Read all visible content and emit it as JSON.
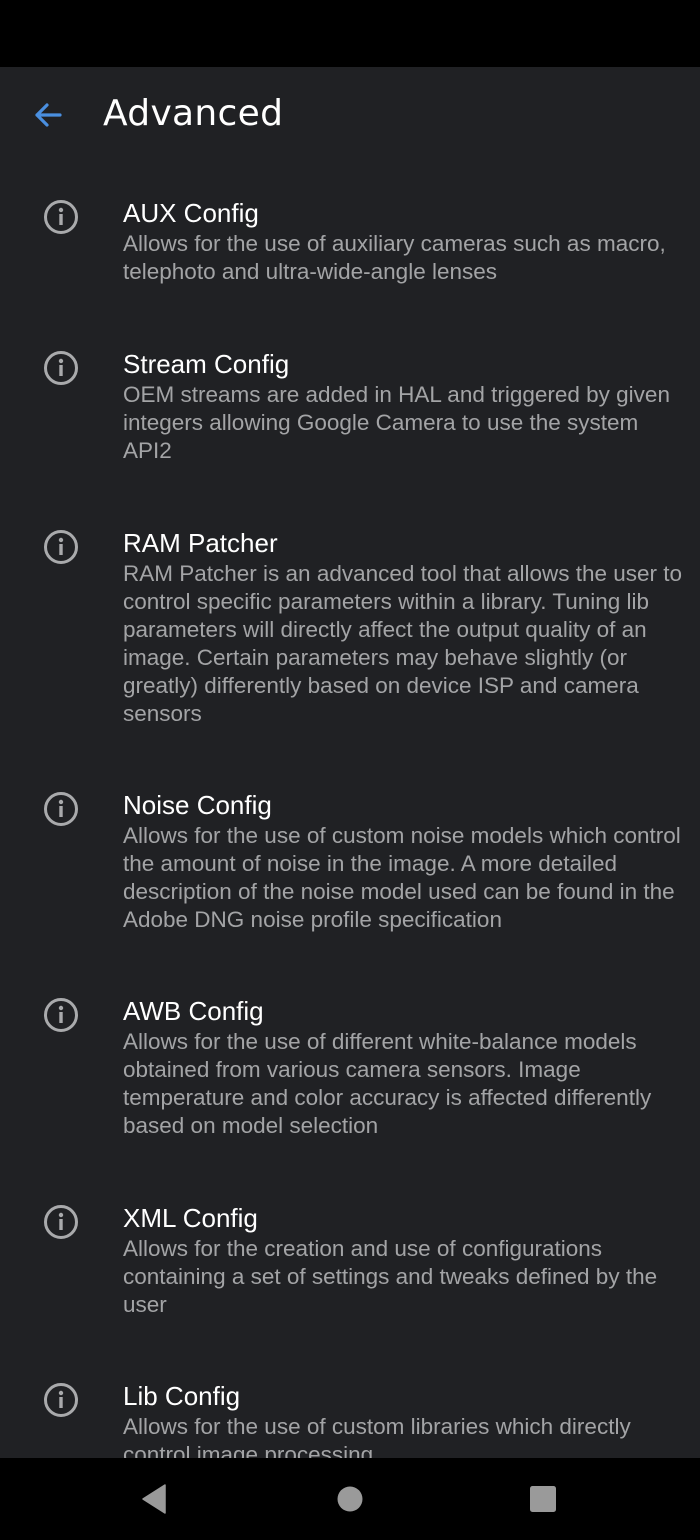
{
  "app_bar": {
    "title": "Advanced",
    "back_icon": "arrow-back-icon",
    "accent_color": "#4a8fe0"
  },
  "items": [
    {
      "icon": "info-icon",
      "title": "AUX Config",
      "description": "Allows for the use of auxiliary cameras such as macro, telephoto and ultra-wide-angle lenses"
    },
    {
      "icon": "info-icon",
      "title": "Stream Config",
      "description": "OEM streams are added in HAL and triggered by given integers allowing Google Camera to use the system API2"
    },
    {
      "icon": "info-icon",
      "title": "RAM Patcher",
      "description": "RAM Patcher is an advanced tool that allows the user to control specific parameters within a library. Tuning lib parameters will directly affect the output quality of an image. Certain parameters may behave slightly (or greatly) differently based on device ISP and camera sensors"
    },
    {
      "icon": "info-icon",
      "title": "Noise Config",
      "description": "Allows for the use of custom noise models which control the amount of noise in the image. A more detailed description of the noise model used can be found in the Adobe DNG noise profile specification"
    },
    {
      "icon": "info-icon",
      "title": "AWB Config",
      "description": "Allows for the use of different white-balance models obtained from various camera sensors. Image temperature and color accuracy is affected differently based on model selection"
    },
    {
      "icon": "info-icon",
      "title": "XML Config",
      "description": "Allows for the creation and use of configurations containing a set of settings and tweaks defined by the user"
    },
    {
      "icon": "info-icon",
      "title": "Lib Config",
      "description": "Allows for the use of custom libraries which directly control image processing"
    }
  ],
  "nav_bar": {
    "back": "nav-back-icon",
    "home": "nav-home-icon",
    "recents": "nav-recents-icon"
  }
}
